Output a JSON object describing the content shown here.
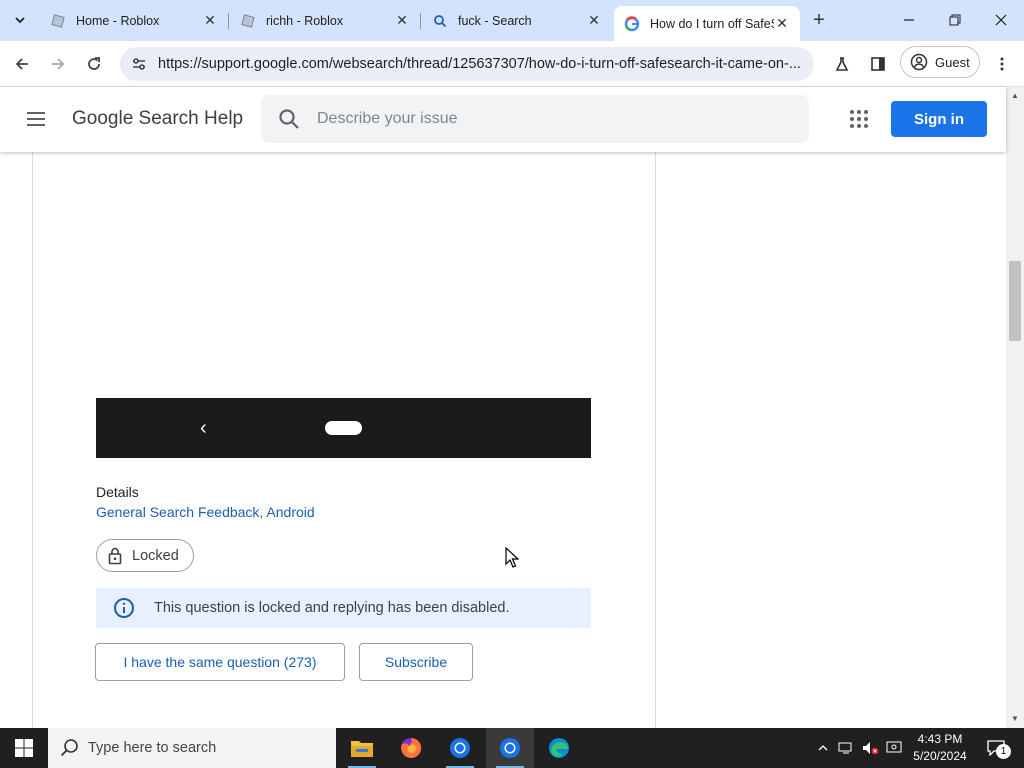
{
  "browser": {
    "tabs": [
      {
        "title": "Home - Roblox",
        "active": false
      },
      {
        "title": "richh - Roblox",
        "active": false
      },
      {
        "title": "fuck - Search",
        "active": false
      },
      {
        "title": "How do I turn off SafeSearch",
        "active": true
      }
    ],
    "url": "https://support.google.com/websearch/thread/125637307/how-do-i-turn-off-safesearch-it-came-on-...",
    "profile_label": "Guest"
  },
  "header": {
    "brand": "Google Search Help",
    "search_placeholder": "Describe your issue",
    "signin_label": "Sign in"
  },
  "thread": {
    "details_label": "Details",
    "details_link": "General Search Feedback, Android",
    "locked_label": "Locked",
    "notice_text": "This question is locked and replying has been disabled.",
    "same_question_label": "I have the same question (273)",
    "subscribe_label": "Subscribe"
  },
  "taskbar": {
    "search_placeholder": "Type here to search",
    "time": "4:43 PM",
    "date": "5/20/2024",
    "notification_count": "1"
  },
  "colors": {
    "tabstrip": "#d3e3fd",
    "accent": "#1a73e8",
    "link": "#1a5fb4",
    "notice_bg": "#e8f0fe"
  }
}
